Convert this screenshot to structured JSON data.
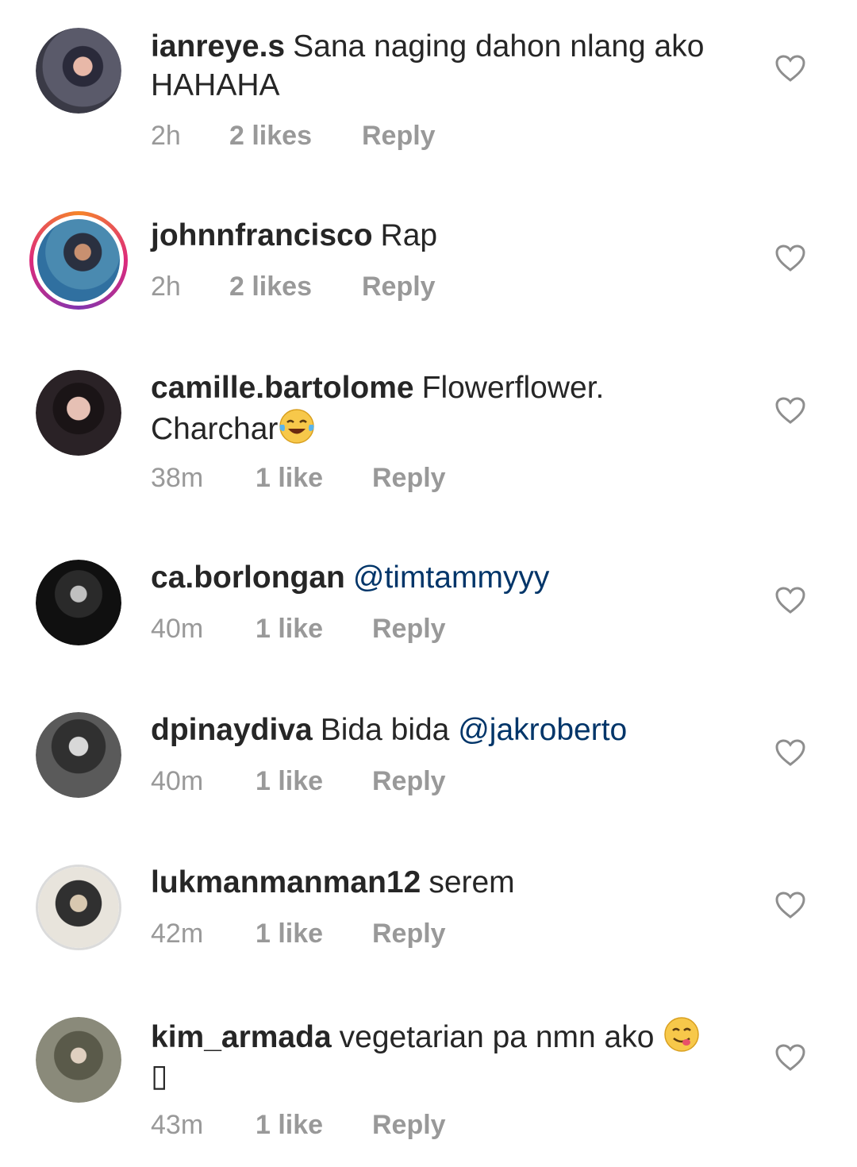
{
  "comments": [
    {
      "username": "ianreye.s",
      "text": "Sana naging dahon nlang ako HAHAHA",
      "mention": "",
      "time": "2h",
      "likes": "2 likes",
      "reply": "Reply",
      "emoji": ""
    },
    {
      "username": "johnnfrancisco",
      "text": "Rap",
      "mention": "",
      "time": "2h",
      "likes": "2 likes",
      "reply": "Reply",
      "emoji": ""
    },
    {
      "username": "camille.bartolome",
      "text": "Flowerflower. Charchar",
      "mention": "",
      "time": "38m",
      "likes": "1 like",
      "reply": "Reply",
      "emoji": "tears-of-joy-emoji"
    },
    {
      "username": "ca.borlongan",
      "text": "",
      "mention": "@timtammyyy",
      "time": "40m",
      "likes": "1 like",
      "reply": "Reply",
      "emoji": ""
    },
    {
      "username": "dpinaydiva",
      "text": "Bida bida",
      "mention": "@jakroberto",
      "time": "40m",
      "likes": "1 like",
      "reply": "Reply",
      "emoji": ""
    },
    {
      "username": "lukmanmanman12",
      "text": "serem",
      "mention": "",
      "time": "42m",
      "likes": "1 like",
      "reply": "Reply",
      "emoji": ""
    },
    {
      "username": "kim_armada",
      "text": "vegetarian pa nmn ako",
      "mention": "",
      "time": "43m",
      "likes": "1 like",
      "reply": "Reply",
      "emoji": "yum-emoji",
      "trailing_glyph": "▯"
    }
  ],
  "colors": {
    "username": "#262626",
    "meta": "#999999",
    "mention": "#003569",
    "story_ring": "#dd2a7b"
  },
  "icons": {
    "like": "heart-outline-icon"
  }
}
